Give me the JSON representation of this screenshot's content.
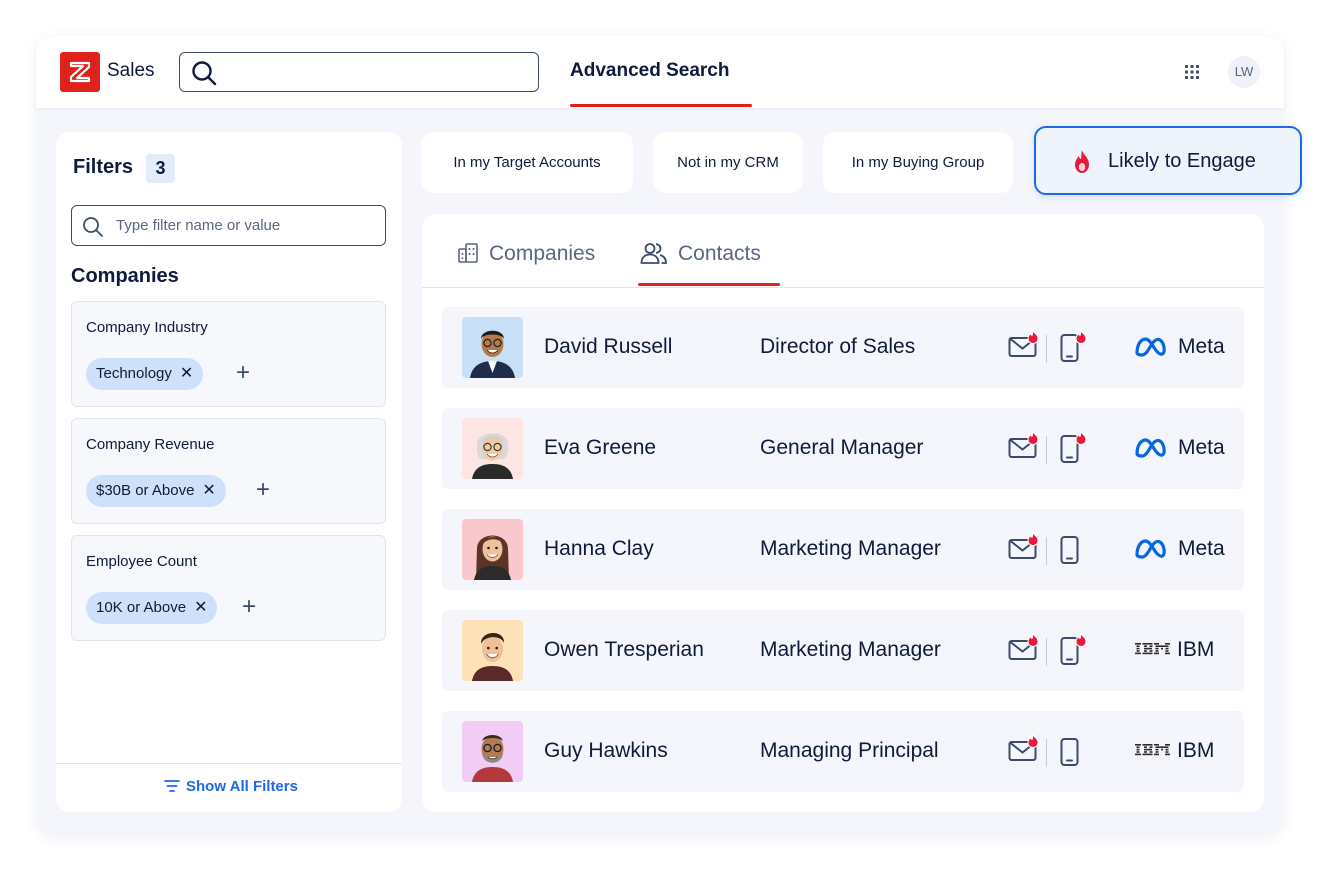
{
  "header": {
    "app_name": "Sales",
    "search_value": "",
    "active_tab": "Advanced Search",
    "user_initials": "LW"
  },
  "filters": {
    "title": "Filters",
    "count": "3",
    "search_placeholder": "Type filter name or value",
    "section_title": "Companies",
    "groups": [
      {
        "name": "Company Industry",
        "chip": "Technology"
      },
      {
        "name": "Company Revenue",
        "chip": "$30B or Above"
      },
      {
        "name": "Employee Count",
        "chip": "10K or Above"
      }
    ],
    "show_all": "Show All Filters"
  },
  "quick_filters": [
    "In my Target Accounts",
    "Not in my CRM",
    "In my Buying Group",
    "Likely to Engage"
  ],
  "results": {
    "tabs": [
      "Companies",
      "Contacts"
    ],
    "active_tab": "Contacts",
    "contacts": [
      {
        "name": "David Russell",
        "title": "Director of Sales",
        "company": "Meta",
        "email_hot": true,
        "phone_hot": true
      },
      {
        "name": "Eva Greene",
        "title": "General Manager",
        "company": "Meta",
        "email_hot": true,
        "phone_hot": true
      },
      {
        "name": "Hanna Clay",
        "title": "Marketing Manager",
        "company": "Meta",
        "email_hot": true,
        "phone_hot": false
      },
      {
        "name": "Owen Tresperian",
        "title": "Marketing Manager",
        "company": "IBM",
        "email_hot": true,
        "phone_hot": true
      },
      {
        "name": "Guy Hawkins",
        "title": "Managing Principal",
        "company": "IBM",
        "email_hot": true,
        "phone_hot": false
      }
    ]
  },
  "colors": {
    "brand_red": "#e0221d",
    "accent_blue": "#1d6ae5",
    "chip_bg": "#cfe0fb",
    "hot_flame": "#e8193c"
  }
}
